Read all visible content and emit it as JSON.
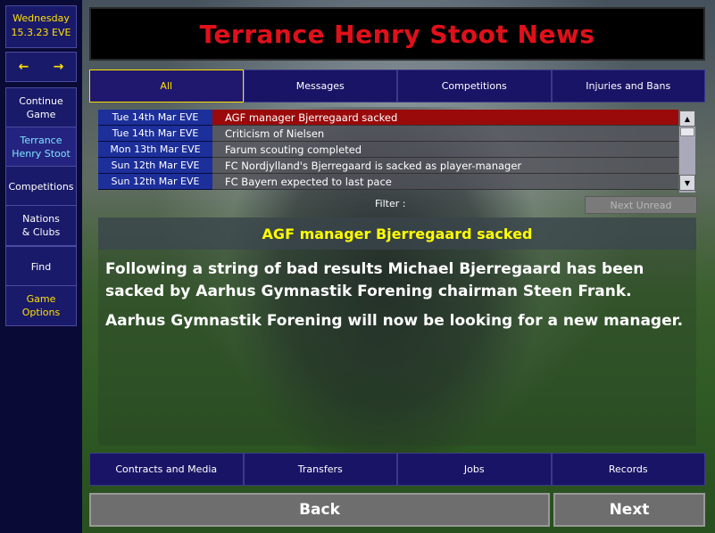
{
  "sidebar": {
    "date_day": "Wednesday",
    "date_value": "15.3.23 EVE",
    "prev_icon": "←",
    "next_icon": "→",
    "continue_line1": "Continue",
    "continue_line2": "Game",
    "profile_line1": "Terrance",
    "profile_line2": "Henry Stoot",
    "competitions": "Competitions",
    "nations_line1": "Nations",
    "nations_line2": "& Clubs",
    "find": "Find",
    "options_line1": "Game",
    "options_line2": "Options"
  },
  "header": {
    "title": "Terrance Henry Stoot News"
  },
  "tabs": [
    {
      "label": "All"
    },
    {
      "label": "Messages"
    },
    {
      "label": "Competitions"
    },
    {
      "label": "Injuries and Bans"
    }
  ],
  "news": [
    {
      "date": "Tue 14th Mar EVE",
      "title": "AGF manager Bjerregaard sacked"
    },
    {
      "date": "Tue 14th Mar EVE",
      "title": "Criticism of Nielsen"
    },
    {
      "date": "Mon 13th Mar EVE",
      "title": "Farum scouting completed"
    },
    {
      "date": "Sun 12th Mar EVE",
      "title": "FC Nordjylland's Bjerregaard is sacked as player-manager"
    },
    {
      "date": "Sun 12th Mar EVE",
      "title": "FC Bayern expected to last pace"
    }
  ],
  "filter": {
    "label": "Filter :",
    "next_unread": "Next Unread"
  },
  "article": {
    "headline": "AGF manager Bjerregaard sacked",
    "para1": "Following a string of bad results Michael Bjerregaard has been sacked by Aarhus Gymnastik Forening chairman Steen Frank.",
    "para2": "Aarhus Gymnastik Forening will now be looking for a new manager."
  },
  "bottom_tabs": [
    {
      "label": "Contracts and Media"
    },
    {
      "label": "Transfers"
    },
    {
      "label": "Jobs"
    },
    {
      "label": "Records"
    }
  ],
  "footer": {
    "back": "Back",
    "next": "Next"
  },
  "colors": {
    "title_red": "#e0101a",
    "highlight_yellow": "#ffe000",
    "selected_row": "#9a0a0a"
  }
}
